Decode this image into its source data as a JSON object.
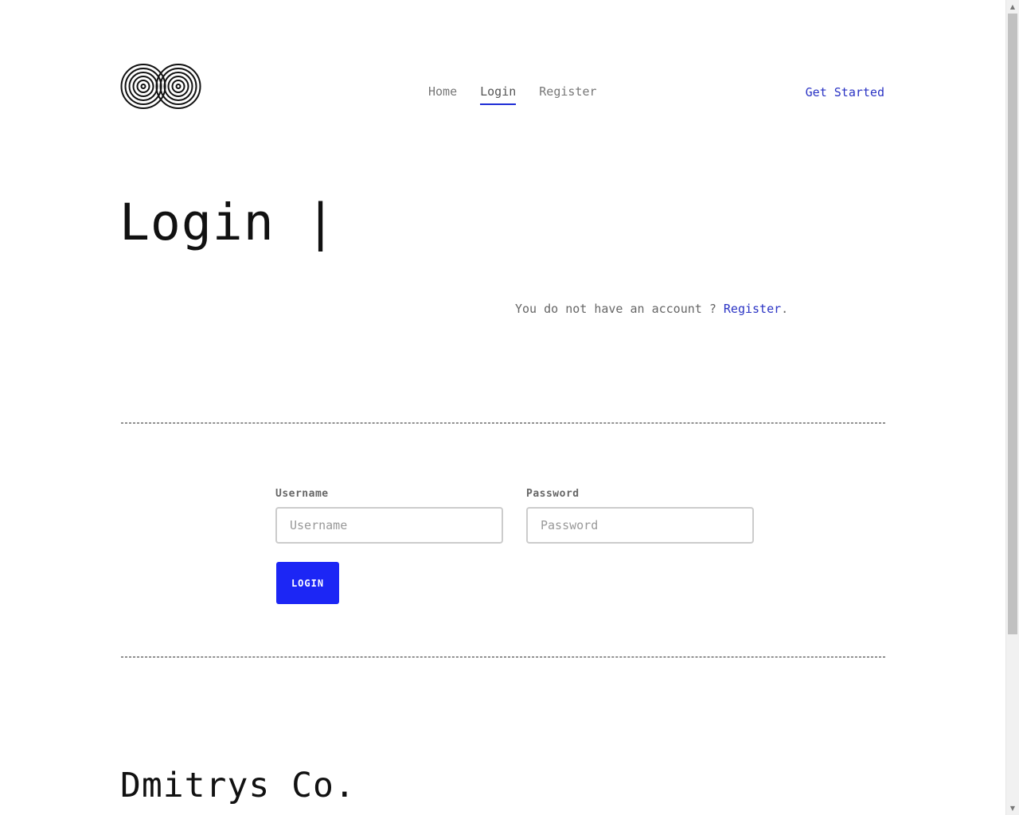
{
  "header": {
    "logo_icon": "double-spiral-logo",
    "nav": [
      {
        "label": "Home",
        "active": false
      },
      {
        "label": "Login",
        "active": true
      },
      {
        "label": "Register",
        "active": false
      }
    ],
    "cta_label": "Get Started"
  },
  "main": {
    "title": "Login |",
    "subtext_prefix": "You do not have an account ? ",
    "subtext_link": "Register",
    "subtext_suffix": "."
  },
  "form": {
    "username_label": "Username",
    "username_placeholder": "Username",
    "username_value": "",
    "password_label": "Password",
    "password_placeholder": "Password",
    "password_value": "",
    "submit_label": "LOGIN"
  },
  "footer": {
    "company_name": "Dmitrys Co."
  },
  "colors": {
    "accent": "#1c26f5",
    "link": "#2a33c4",
    "text": "#111111",
    "muted": "#777777"
  }
}
